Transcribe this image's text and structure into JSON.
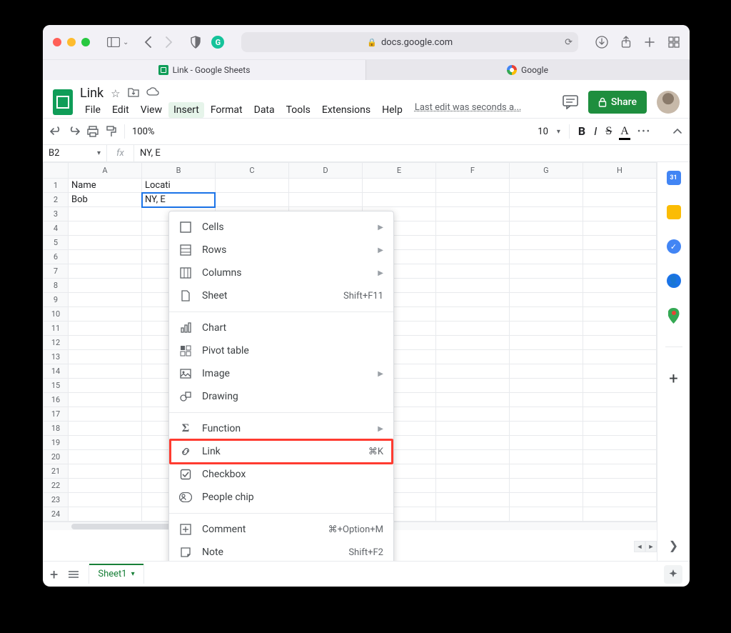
{
  "browser": {
    "url_host": "docs.google.com",
    "tabs": [
      {
        "label": "Link - Google Sheets",
        "active": true,
        "icon": "sheets"
      },
      {
        "label": "Google",
        "active": false,
        "icon": "google"
      }
    ]
  },
  "doc": {
    "title": "Link",
    "menus": [
      "File",
      "Edit",
      "View",
      "Insert",
      "Format",
      "Data",
      "Tools",
      "Extensions",
      "Help"
    ],
    "open_menu_index": 3,
    "last_edit": "Last edit was seconds a...",
    "share_label": "Share"
  },
  "toolbar": {
    "zoom": "100%",
    "font_size": "10"
  },
  "cell_ref": {
    "name": "B2",
    "formula": "NY, E"
  },
  "grid": {
    "columns": [
      "A",
      "B",
      "C",
      "D",
      "E",
      "F",
      "G",
      "H"
    ],
    "rows": 24,
    "selected_cell": "B2",
    "data": {
      "A1": "Name",
      "B1": "Locati",
      "A2": "Bob",
      "B2": "NY, E"
    }
  },
  "insert_menu": {
    "groups": [
      [
        {
          "icon": "cells",
          "label": "Cells",
          "sub": true
        },
        {
          "icon": "rows",
          "label": "Rows",
          "sub": true
        },
        {
          "icon": "columns",
          "label": "Columns",
          "sub": true
        },
        {
          "icon": "sheet",
          "label": "Sheet",
          "shortcut": "Shift+F11"
        }
      ],
      [
        {
          "icon": "chart",
          "label": "Chart"
        },
        {
          "icon": "pivot",
          "label": "Pivot table"
        },
        {
          "icon": "image",
          "label": "Image",
          "sub": true
        },
        {
          "icon": "drawing",
          "label": "Drawing"
        }
      ],
      [
        {
          "icon": "function",
          "label": "Function",
          "sub": true
        },
        {
          "icon": "link",
          "label": "Link",
          "shortcut": "⌘K",
          "highlight": true
        },
        {
          "icon": "checkbox",
          "label": "Checkbox"
        },
        {
          "icon": "people",
          "label": "People chip"
        }
      ],
      [
        {
          "icon": "comment",
          "label": "Comment",
          "shortcut": "⌘+Option+M"
        },
        {
          "icon": "note",
          "label": "Note",
          "shortcut": "Shift+F2"
        }
      ]
    ]
  },
  "sheet_tabs": {
    "active": "Sheet1"
  }
}
